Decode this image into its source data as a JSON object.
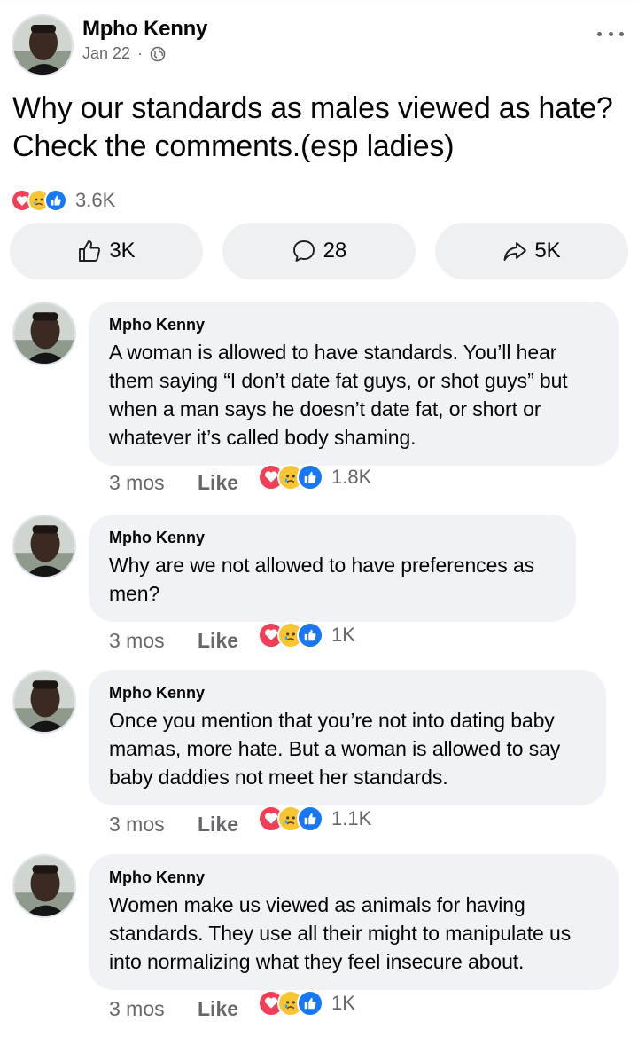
{
  "post": {
    "author": "Mpho Kenny",
    "date": "Jan 22",
    "separator": "·",
    "text": "Why our standards as males viewed as hate? Check the comments.(esp ladies)",
    "reaction_count": "3.6K",
    "reactions": [
      "love",
      "sad",
      "like"
    ],
    "actions": {
      "like_count": "3K",
      "comment_count": "28",
      "share_count": "5K"
    }
  },
  "comments": [
    {
      "author": "Mpho Kenny",
      "text": "A woman is allowed to have standards. You’ll hear them saying “I don’t date fat guys, or shot guys” but when a man says he doesn’t date fat, or short or whatever it’s called body shaming.",
      "time": "3 mos",
      "like_label": "Like",
      "reaction_count": "1.8K"
    },
    {
      "author": "Mpho Kenny",
      "text": "Why are we not allowed to have preferences as men?",
      "time": "3 mos",
      "like_label": "Like",
      "reaction_count": "1K"
    },
    {
      "author": "Mpho Kenny",
      "text": "Once you mention that you’re not into dating baby mamas, more hate. But a woman is allowed to say baby daddies not meet her standards.",
      "time": "3 mos",
      "like_label": "Like",
      "reaction_count": "1.1K"
    },
    {
      "author": "Mpho Kenny",
      "text": "Women make us viewed as animals for having standards. They use all their might to manipulate us into normalizing what they feel insecure about.",
      "time": "3 mos",
      "like_label": "Like",
      "reaction_count": "1K"
    }
  ],
  "colors": {
    "love": "#f33e58",
    "sad": "#f7b125",
    "like": "#1877f2",
    "bubble": "#f0f2f5",
    "muted": "#65676b"
  }
}
